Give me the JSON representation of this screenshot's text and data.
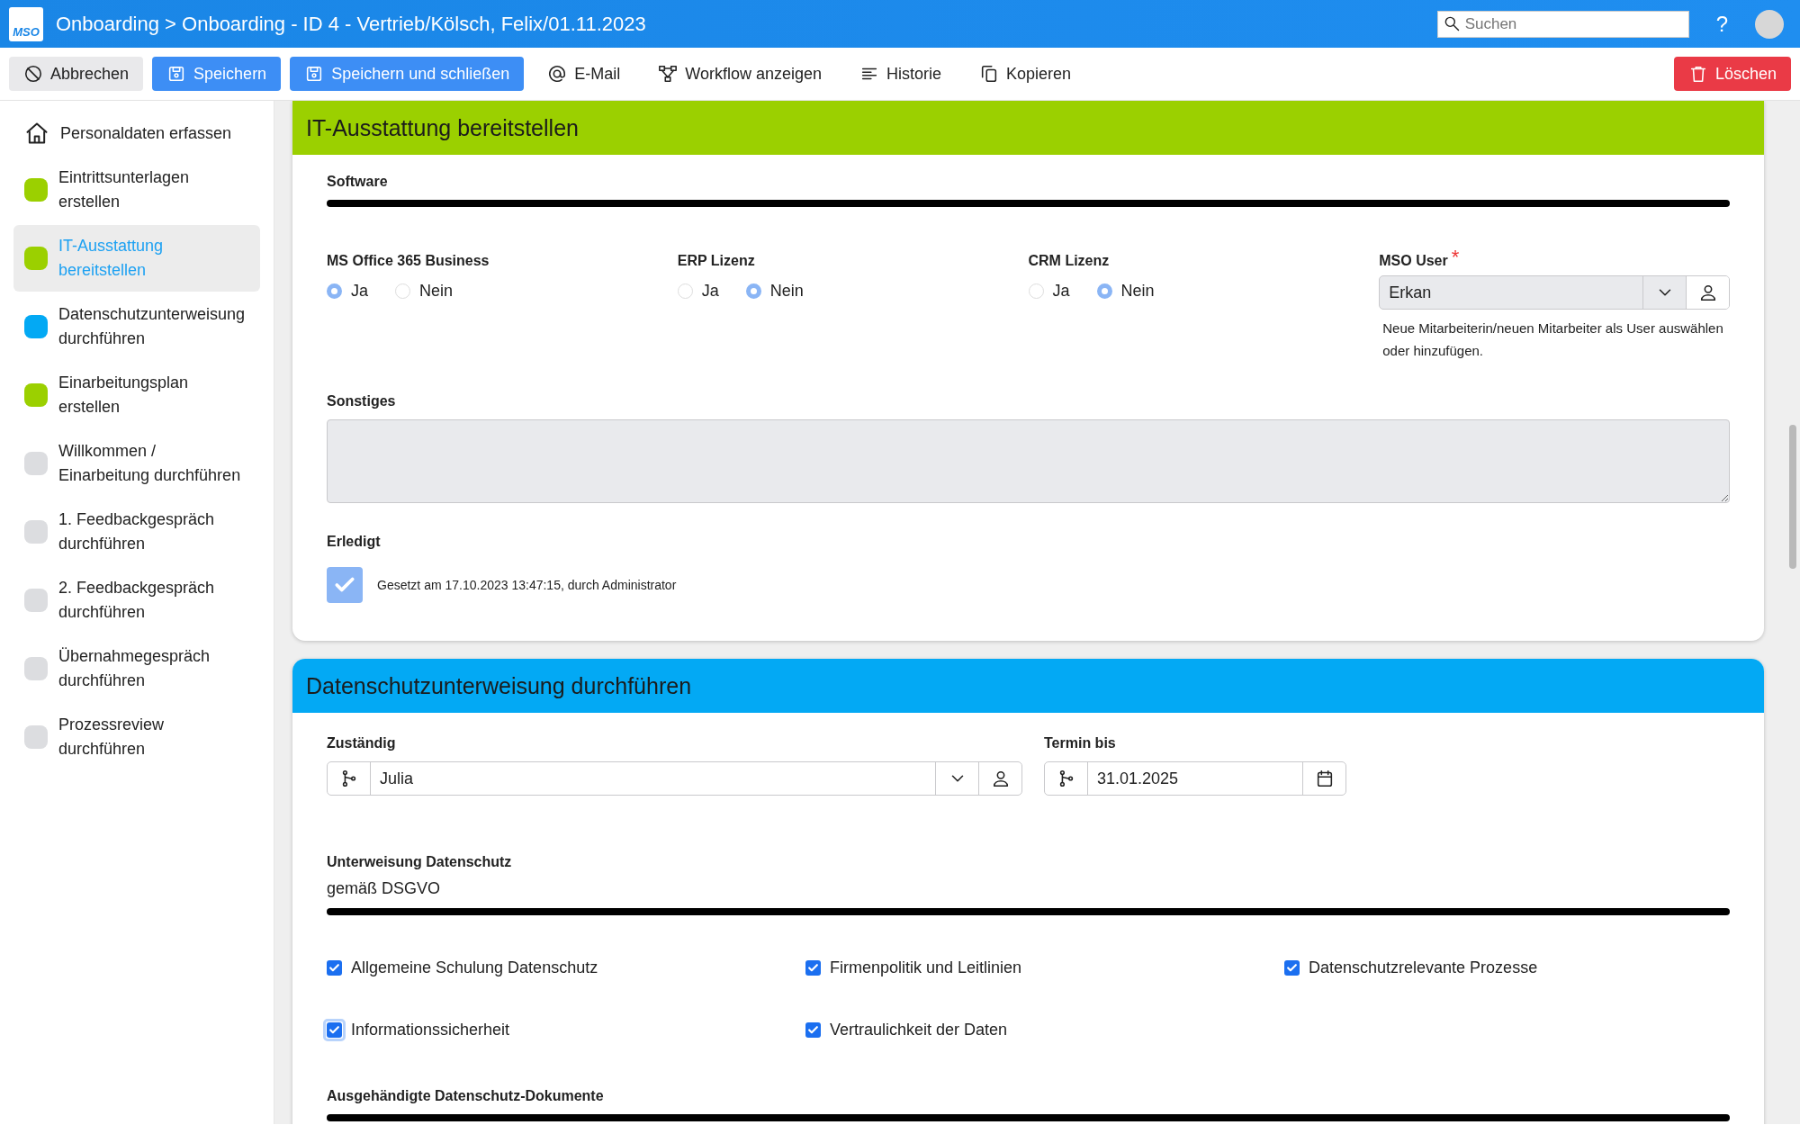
{
  "header": {
    "logo": "MSO",
    "title": "Onboarding > Onboarding - ID 4 - Vertrieb/Kölsch, Felix/01.11.2023",
    "search": {
      "placeholder": "Suchen"
    },
    "help": "?"
  },
  "toolbar": [
    {
      "label": "Abbrechen",
      "kind": "light"
    },
    {
      "label": "Speichern",
      "kind": "primary"
    },
    {
      "label": "Speichern und schließen",
      "kind": "primary"
    },
    {
      "label": "E-Mail",
      "kind": "plain"
    },
    {
      "label": "Workflow anzeigen",
      "kind": "plain"
    },
    {
      "label": "Historie",
      "kind": "plain"
    },
    {
      "label": "Kopieren",
      "kind": "plain"
    },
    {
      "label": "Löschen",
      "kind": "danger"
    }
  ],
  "sidebar": {
    "items": [
      {
        "label": "Personaldaten erfassen",
        "kind": "home",
        "selected": false
      },
      {
        "label": "Eintrittsunterlagen erstellen",
        "kind": "dot",
        "color": "#9bd000",
        "selected": false
      },
      {
        "label": "IT-Ausstattung bereitstellen",
        "kind": "dot",
        "color": "#9bd000",
        "selected": true
      },
      {
        "label": "Datenschutzunterweisung durchführen",
        "kind": "dot",
        "color": "#03a9f4",
        "selected": false
      },
      {
        "label": "Einarbeitungsplan erstellen",
        "kind": "dot",
        "color": "#9bd000",
        "selected": false
      },
      {
        "label": "Willkommen / Einarbeitung durchführen",
        "kind": "dot",
        "color": "#dcdde0",
        "selected": false
      },
      {
        "label": "1. Feedbackgespräch durchführen",
        "kind": "dot",
        "color": "#dcdde0",
        "selected": false
      },
      {
        "label": "2. Feedbackgespräch durchführen",
        "kind": "dot",
        "color": "#dcdde0",
        "selected": false
      },
      {
        "label": "Übernahmegespräch durchführen",
        "kind": "dot",
        "color": "#dcdde0",
        "selected": false
      },
      {
        "label": "Prozessreview durchführen",
        "kind": "dot",
        "color": "#dcdde0",
        "selected": false
      }
    ]
  },
  "it_card": {
    "title": "IT-Ausstattung bereitstellen",
    "color": "#9bd000",
    "section": "Software",
    "radio_groups": [
      {
        "label": "MS Office 365 Business",
        "options": [
          {
            "label": "Ja",
            "selected": true
          },
          {
            "label": "Nein",
            "selected": false
          }
        ]
      },
      {
        "label": "ERP Lizenz",
        "options": [
          {
            "label": "Ja",
            "selected": false
          },
          {
            "label": "Nein",
            "selected": true
          }
        ]
      },
      {
        "label": "CRM Lizenz",
        "options": [
          {
            "label": "Ja",
            "selected": false
          },
          {
            "label": "Nein",
            "selected": true
          }
        ]
      }
    ],
    "user_field": {
      "label": "MSO User",
      "required_mark": "*",
      "value": "Erkan",
      "help": "Neue Mitarbeiterin/neuen Mitarbeiter als User auswählen oder hinzufügen."
    },
    "other": {
      "label": "Sonstiges"
    },
    "done": {
      "label": "Erledigt",
      "checked": true,
      "note": "Gesetzt am 17.10.2023 13:47:15, durch Administrator"
    }
  },
  "privacy_card": {
    "title": "Datenschutzunterweisung durchführen",
    "color": "#03a9f4",
    "responsible": {
      "label": "Zuständig",
      "value": "Julia"
    },
    "due": {
      "label": "Termin bis",
      "value": "31.01.2025"
    },
    "section": "Unterweisung Datenschutz",
    "section_note": "gemäß DSGVO",
    "checkboxes": [
      {
        "label": "Allgemeine Schulung Datenschutz",
        "checked": true
      },
      {
        "label": "Firmenpolitik und Leitlinien",
        "checked": true
      },
      {
        "label": "Datenschutzrelevante Prozesse",
        "checked": true
      },
      {
        "label": "Informationssicherheit",
        "checked": true,
        "focused": true
      },
      {
        "label": "Vertraulichkeit der Daten",
        "checked": true
      }
    ],
    "next_section": "Ausgehändigte Datenschutz-Dokumente"
  }
}
